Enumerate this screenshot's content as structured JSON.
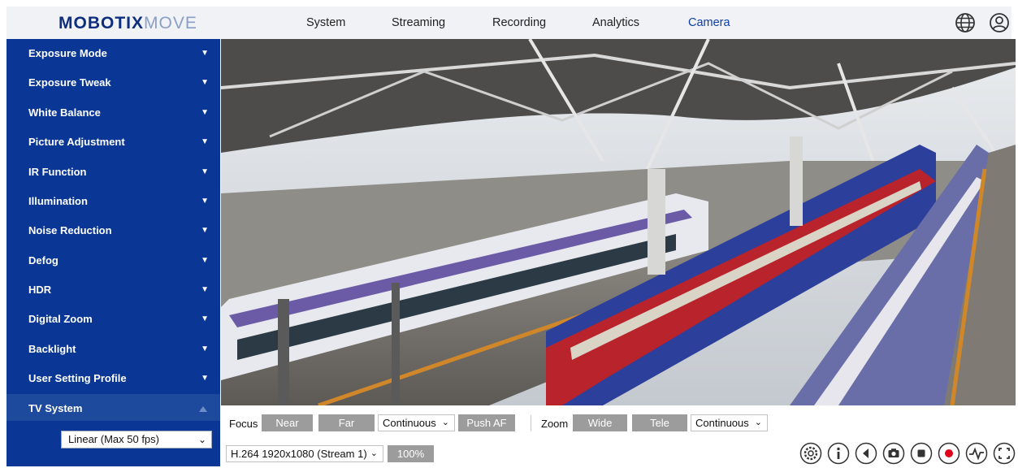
{
  "header": {
    "brand": "MOBOTIX",
    "brand_suffix": "MOVE",
    "nav": [
      "System",
      "Streaming",
      "Recording",
      "Analytics",
      "Camera"
    ],
    "active_nav": "Camera",
    "icons": [
      "globe-icon",
      "user-icon"
    ]
  },
  "sidebar": {
    "items": [
      "Exposure Mode",
      "Exposure Tweak",
      "White Balance",
      "Picture Adjustment",
      "IR Function",
      "Illumination",
      "Noise Reduction",
      "Defog",
      "HDR",
      "Digital Zoom",
      "Backlight",
      "User Setting Profile",
      "TV System"
    ],
    "expanded": "TV System",
    "tv_system_value": "Linear (Max 50 fps)"
  },
  "focus": {
    "label": "Focus",
    "near": "Near",
    "far": "Far",
    "mode": "Continuous",
    "push_af": "Push AF"
  },
  "zoom": {
    "label": "Zoom",
    "wide": "Wide",
    "tele": "Tele",
    "mode": "Continuous"
  },
  "stream": {
    "selected": "H.264 1920x1080 (Stream 1)",
    "scale": "100%"
  },
  "player_icons": [
    "settings-icon",
    "info-icon",
    "audio-icon",
    "snapshot-icon",
    "stop-icon",
    "record-icon",
    "activity-icon",
    "fullscreen-icon"
  ],
  "colors": {
    "sidebar": "#0a3795",
    "accent": "#0d3fa8",
    "button_gray": "#9c9c9c",
    "record": "#e3001b"
  }
}
